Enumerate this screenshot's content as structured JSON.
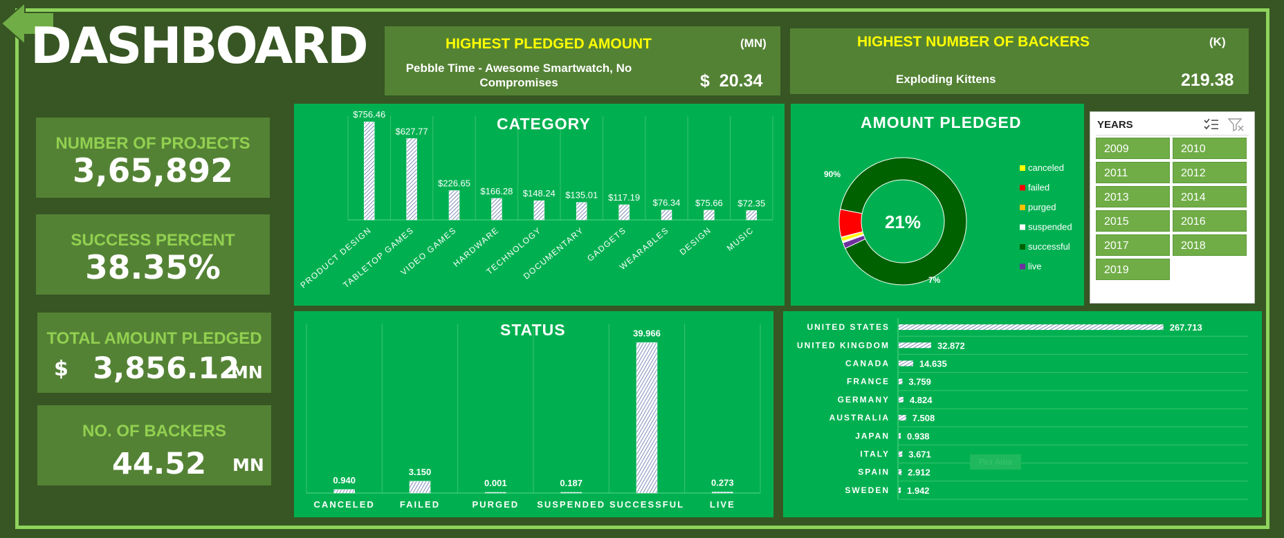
{
  "title": "DASHBOARD",
  "highest_pledged": {
    "heading": "HIGHEST PLEDGED AMOUNT",
    "unit": "(MN)",
    "project": "Pebble Time - Awesome Smartwatch, No Compromises",
    "value": "$  20.34"
  },
  "highest_backers": {
    "heading": "HIGHEST NUMBER OF BACKERS",
    "unit": "(K)",
    "project": "Exploding Kittens",
    "value": "219.38"
  },
  "kpis": {
    "projects": {
      "label": "NUMBER OF PROJECTS",
      "value": "3,65,892"
    },
    "success": {
      "label": "SUCCESS PERCENT",
      "value": "38.35%"
    },
    "pledged": {
      "label": "TOTAL AMOUNT PLEDGED",
      "currency": "$",
      "value": "3,856.12",
      "unit": "MN"
    },
    "backers": {
      "label": "NO. OF BACKERS",
      "value": "44.52",
      "unit": "MN"
    }
  },
  "years_slicer": {
    "title": "YEARS",
    "years": [
      "2009",
      "2010",
      "2011",
      "2012",
      "2013",
      "2014",
      "2015",
      "2016",
      "2017",
      "2018",
      "2019"
    ]
  },
  "plot_area_label": "Plot Area",
  "chart_data": [
    {
      "type": "bar",
      "title": "CATEGORY",
      "categories": [
        "PRODUCT DESIGN",
        "TABLETOP GAMES",
        "VIDEO GAMES",
        "HARDWARE",
        "TECHNOLOGY",
        "DOCUMENTARY",
        "GADGETS",
        "WEARABLES",
        "DESIGN",
        "MUSIC"
      ],
      "values": [
        756.46,
        627.77,
        226.65,
        166.28,
        148.24,
        135.01,
        117.19,
        76.34,
        75.66,
        72.35
      ],
      "data_labels": [
        "$756.46",
        "$627.77",
        "$226.65",
        "$166.28",
        "$148.24",
        "$135.01",
        "$117.19",
        "$76.34",
        "$75.66",
        "$72.35"
      ],
      "ylim": [
        0,
        800
      ]
    },
    {
      "type": "pie",
      "title": "AMOUNT PLEDGED",
      "center_label": "21%",
      "outer_labels": [
        "90%",
        "7%"
      ],
      "slices": [
        {
          "name": "canceled",
          "value": 1,
          "color": "#ffff00"
        },
        {
          "name": "failed",
          "value": 7,
          "color": "#ff0000"
        },
        {
          "name": "purged",
          "value": 0.1,
          "color": "#ffc000"
        },
        {
          "name": "suspended",
          "value": 0.4,
          "color": "#ffffff"
        },
        {
          "name": "successful",
          "value": 90,
          "color": "#006100"
        },
        {
          "name": "live",
          "value": 1.5,
          "color": "#7030a0"
        }
      ],
      "legend": [
        {
          "name": "canceled",
          "color": "#ffff00"
        },
        {
          "name": "failed",
          "color": "#ff0000"
        },
        {
          "name": "purged",
          "color": "#ffc000"
        },
        {
          "name": "suspended",
          "color": "#ffffff"
        },
        {
          "name": "successful",
          "color": "#006100"
        },
        {
          "name": "live",
          "color": "#7030a0"
        }
      ],
      "legend_position": "right"
    },
    {
      "type": "bar",
      "title": "STATUS",
      "categories": [
        "CANCELED",
        "FAILED",
        "PURGED",
        "SUSPENDED",
        "SUCCESSFUL",
        "LIVE"
      ],
      "values": [
        0.94,
        3.15,
        0.001,
        0.187,
        39.966,
        0.273
      ],
      "data_labels": [
        "0.940",
        "3.150",
        "0.001",
        "0.187",
        "39.966",
        "0.273"
      ],
      "ylim": [
        0,
        45
      ]
    },
    {
      "type": "bar",
      "orientation": "horizontal",
      "categories": [
        "UNITED STATES",
        "UNITED KINGDOM",
        "CANADA",
        "FRANCE",
        "GERMANY",
        "AUSTRALIA",
        "JAPAN",
        "ITALY",
        "SPAIN",
        "SWEDEN"
      ],
      "values": [
        267.713,
        32.872,
        14.635,
        3.759,
        4.824,
        7.508,
        0.938,
        3.671,
        2.912,
        1.942
      ],
      "data_labels": [
        "267.713",
        "32.872",
        "14.635",
        "3.759",
        "4.824",
        "7.508",
        "0.938",
        "3.671",
        "2.912",
        "1.942"
      ],
      "xlim": [
        0,
        270
      ]
    }
  ]
}
